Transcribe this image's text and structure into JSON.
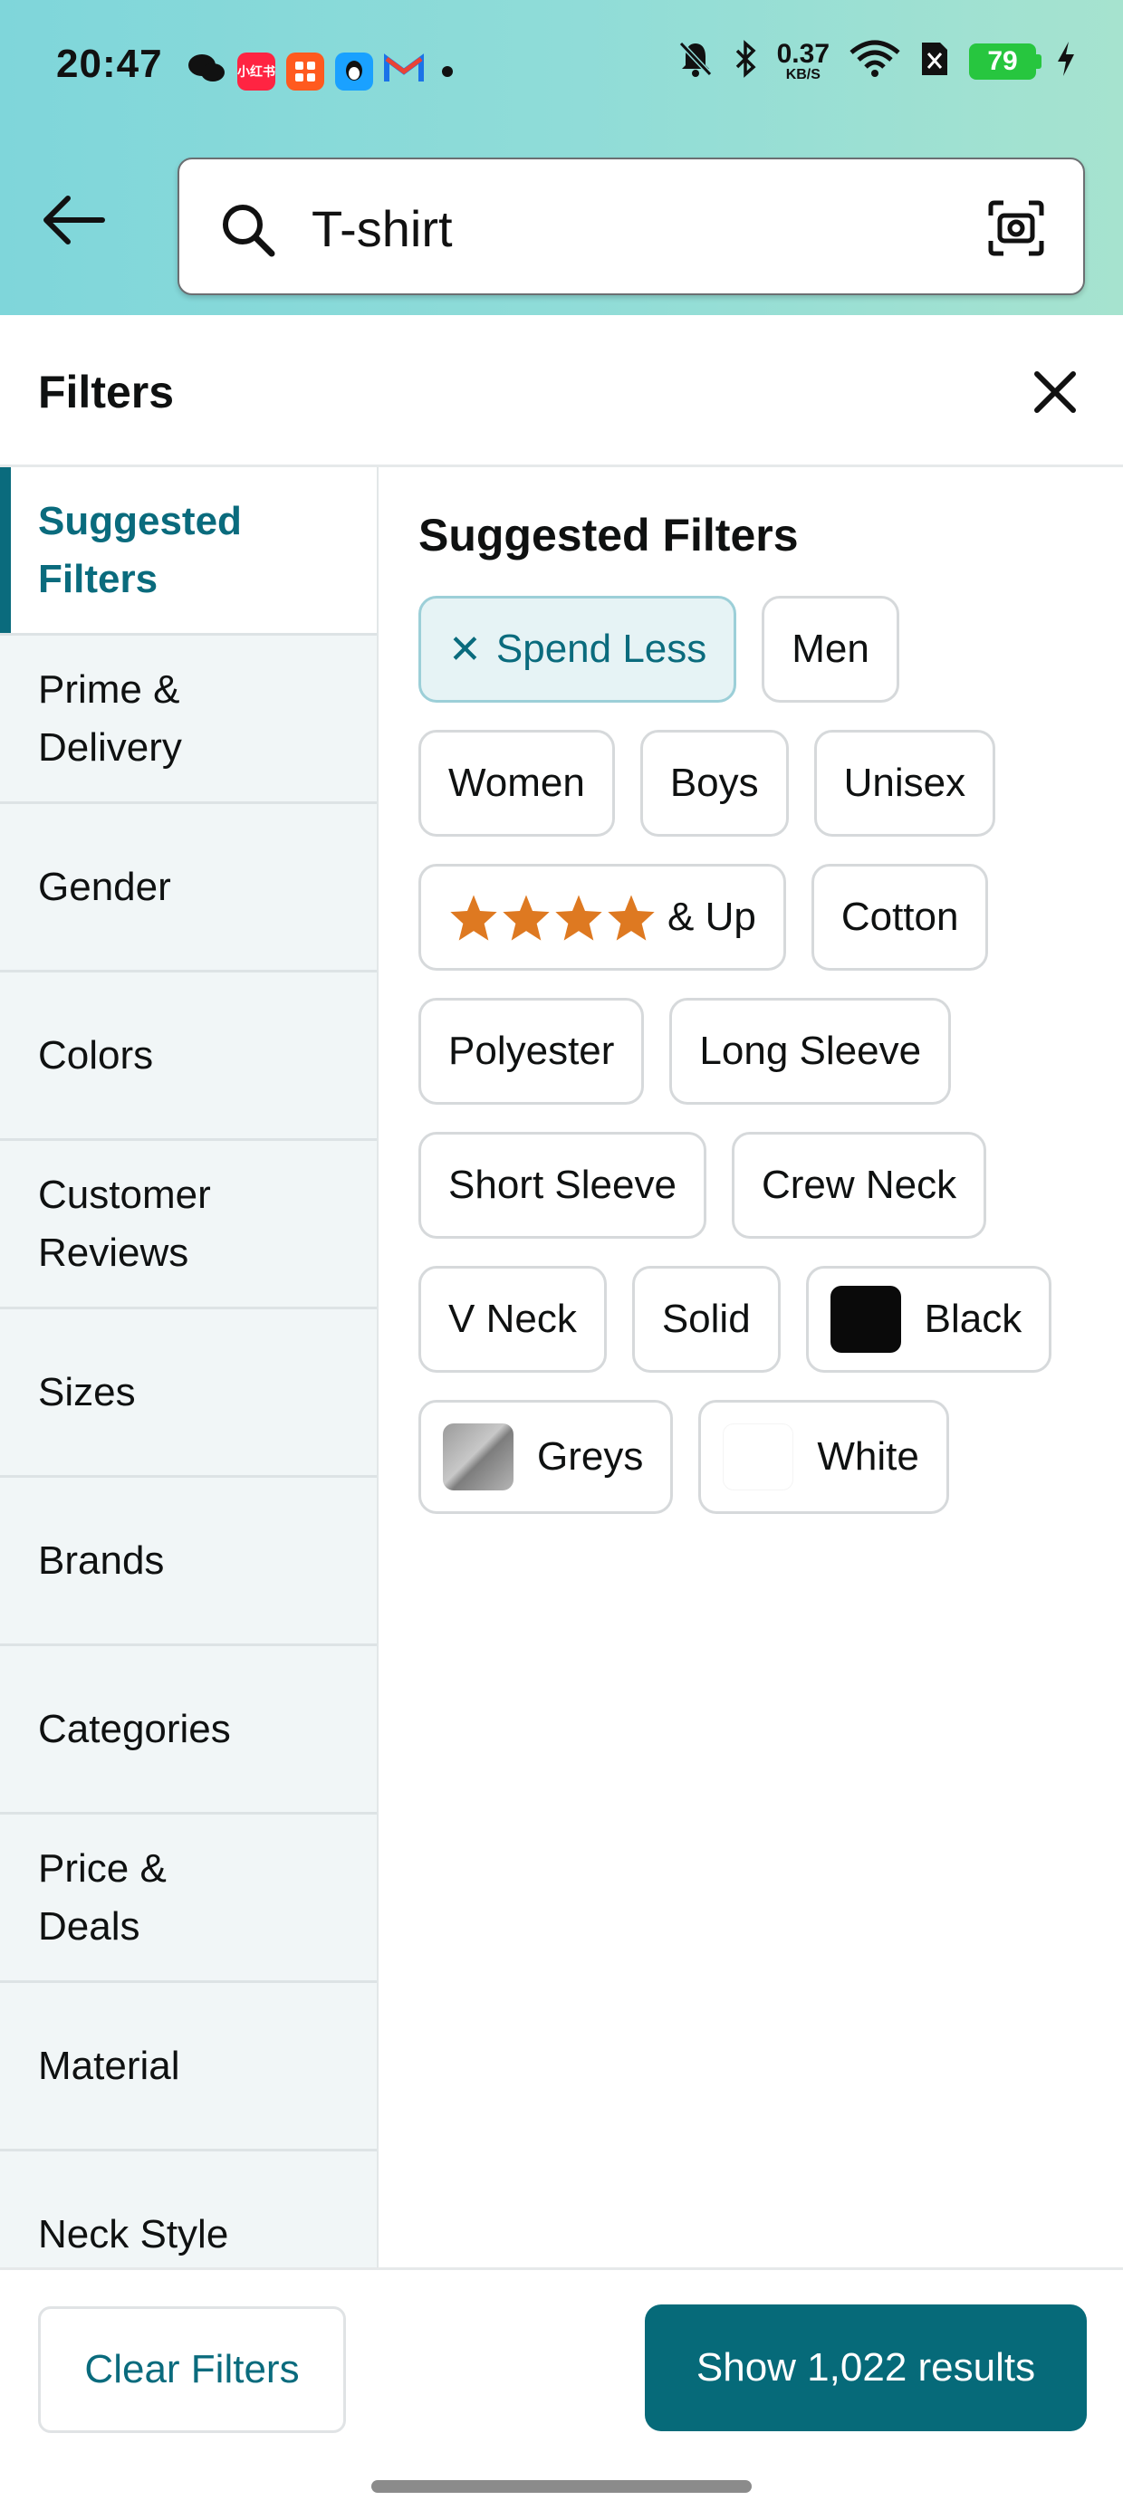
{
  "status_bar": {
    "time": "20:47",
    "speed_value": "0.37",
    "speed_unit": "KB/S",
    "battery": "79",
    "app_badge_1": "小红书"
  },
  "search": {
    "query": "T-shirt"
  },
  "filters": {
    "title": "Filters"
  },
  "sidebar": {
    "items": [
      {
        "label": "Suggested Filters"
      },
      {
        "label": "Prime & Delivery"
      },
      {
        "label": "Gender"
      },
      {
        "label": "Colors"
      },
      {
        "label": "Customer Reviews"
      },
      {
        "label": "Sizes"
      },
      {
        "label": "Brands"
      },
      {
        "label": "Categories"
      },
      {
        "label": "Price & Deals"
      },
      {
        "label": "Material"
      },
      {
        "label": "Neck Style"
      }
    ]
  },
  "main": {
    "heading": "Suggested Filters",
    "chips": {
      "spend_less": "Spend Less",
      "men": "Men",
      "women": "Women",
      "boys": "Boys",
      "unisex": "Unisex",
      "rating_up": "& Up",
      "cotton": "Cotton",
      "polyester": "Polyester",
      "long_sleeve": "Long Sleeve",
      "short_sleeve": "Short Sleeve",
      "crew_neck": "Crew Neck",
      "v_neck": "V Neck",
      "solid": "Solid",
      "black": "Black",
      "greys": "Greys",
      "white": "White"
    },
    "rating_stars": 4
  },
  "footer": {
    "clear_label": "Clear Filters",
    "show_label": "Show 1,022 results"
  },
  "colors": {
    "accent": "#0a6b7d",
    "button": "#066a79",
    "star": "#de7921"
  }
}
